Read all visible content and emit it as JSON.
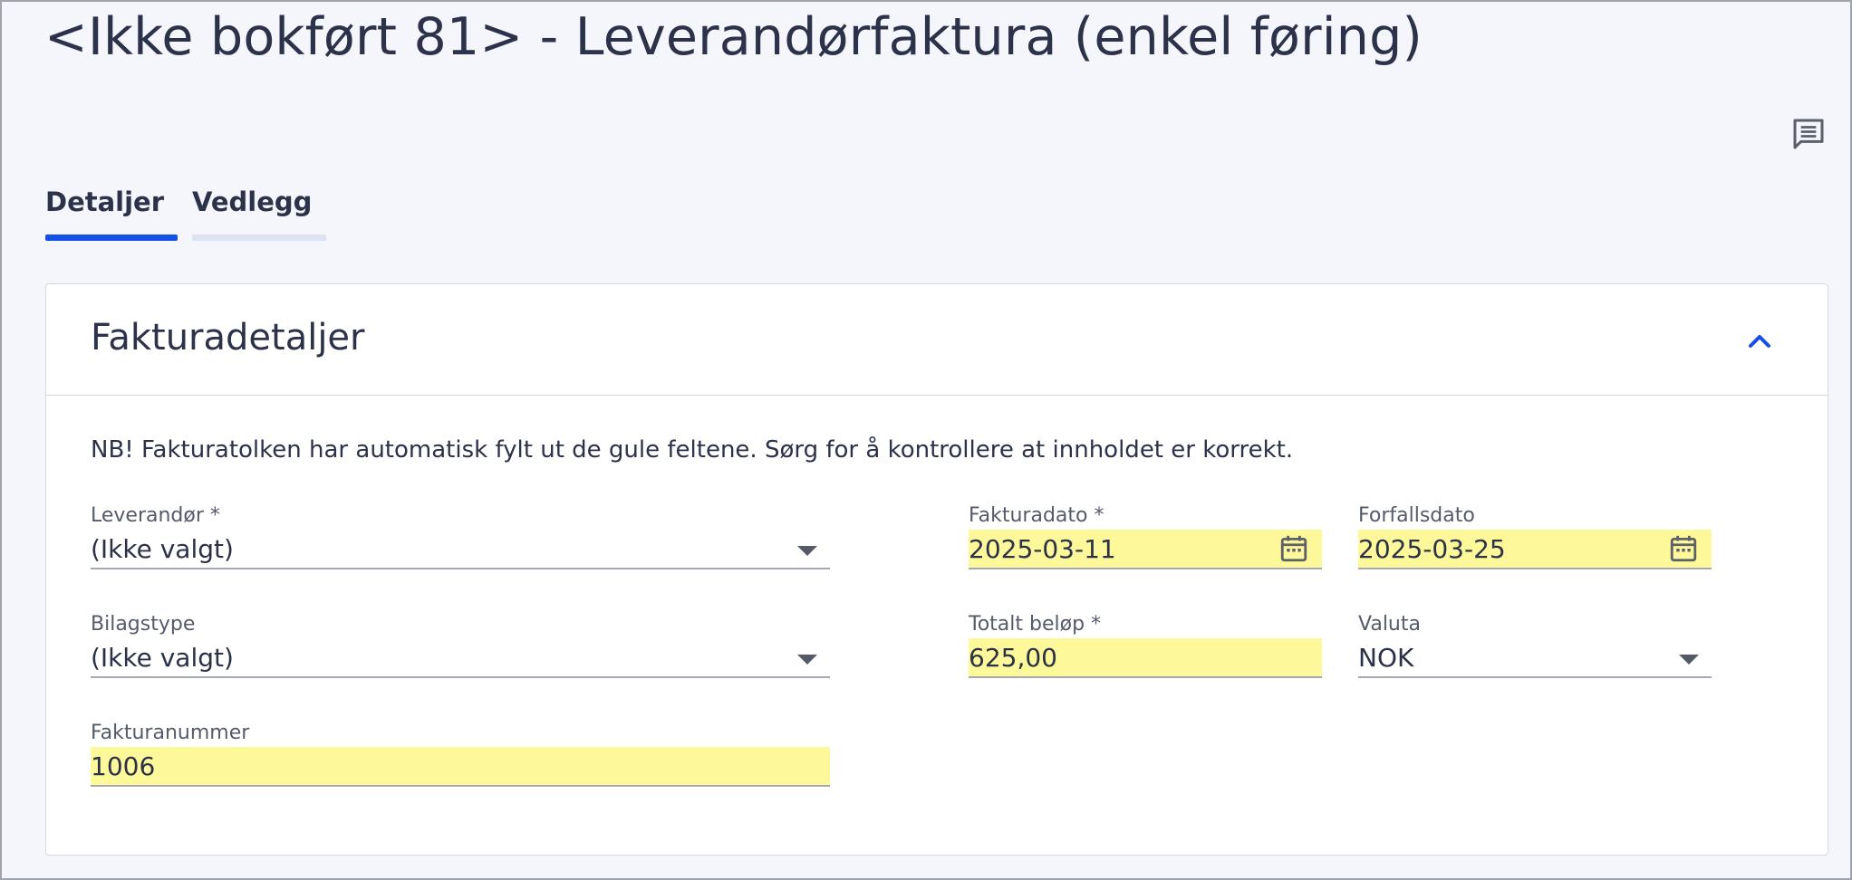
{
  "page": {
    "title": "<Ikke bokført 81> - Leverandørfaktura (enkel føring)"
  },
  "tabs": [
    {
      "label": "Detaljer",
      "active": true
    },
    {
      "label": "Vedlegg",
      "active": false
    }
  ],
  "section": {
    "title": "Fakturadetaljer",
    "notice": "NB! Fakturatolken har automatisk fylt ut de gule feltene. Sørg for å kontrollere at innholdet er korrekt."
  },
  "fields": {
    "leverandor": {
      "label": "Leverandør *",
      "value": "(Ikke valgt)"
    },
    "bilagstype": {
      "label": "Bilagstype",
      "value": "(Ikke valgt)"
    },
    "fakturanummer": {
      "label": "Fakturanummer",
      "value": "1006"
    },
    "fakturadato": {
      "label": "Fakturadato *",
      "value": "2025-03-11"
    },
    "forfallsdato": {
      "label": "Forfallsdato",
      "value": "2025-03-25"
    },
    "totalt_belop": {
      "label": "Totalt beløp *",
      "value": "625,00"
    },
    "valuta": {
      "label": "Valuta",
      "value": "NOK"
    }
  },
  "colors": {
    "accent": "#1450e6",
    "autofill_highlight": "#fdf899",
    "background": "#f4f6fb"
  },
  "icons": {
    "comment": "comment-icon",
    "collapse": "chevron-up-icon",
    "calendar": "calendar-icon",
    "dropdown": "caret-down-icon"
  }
}
